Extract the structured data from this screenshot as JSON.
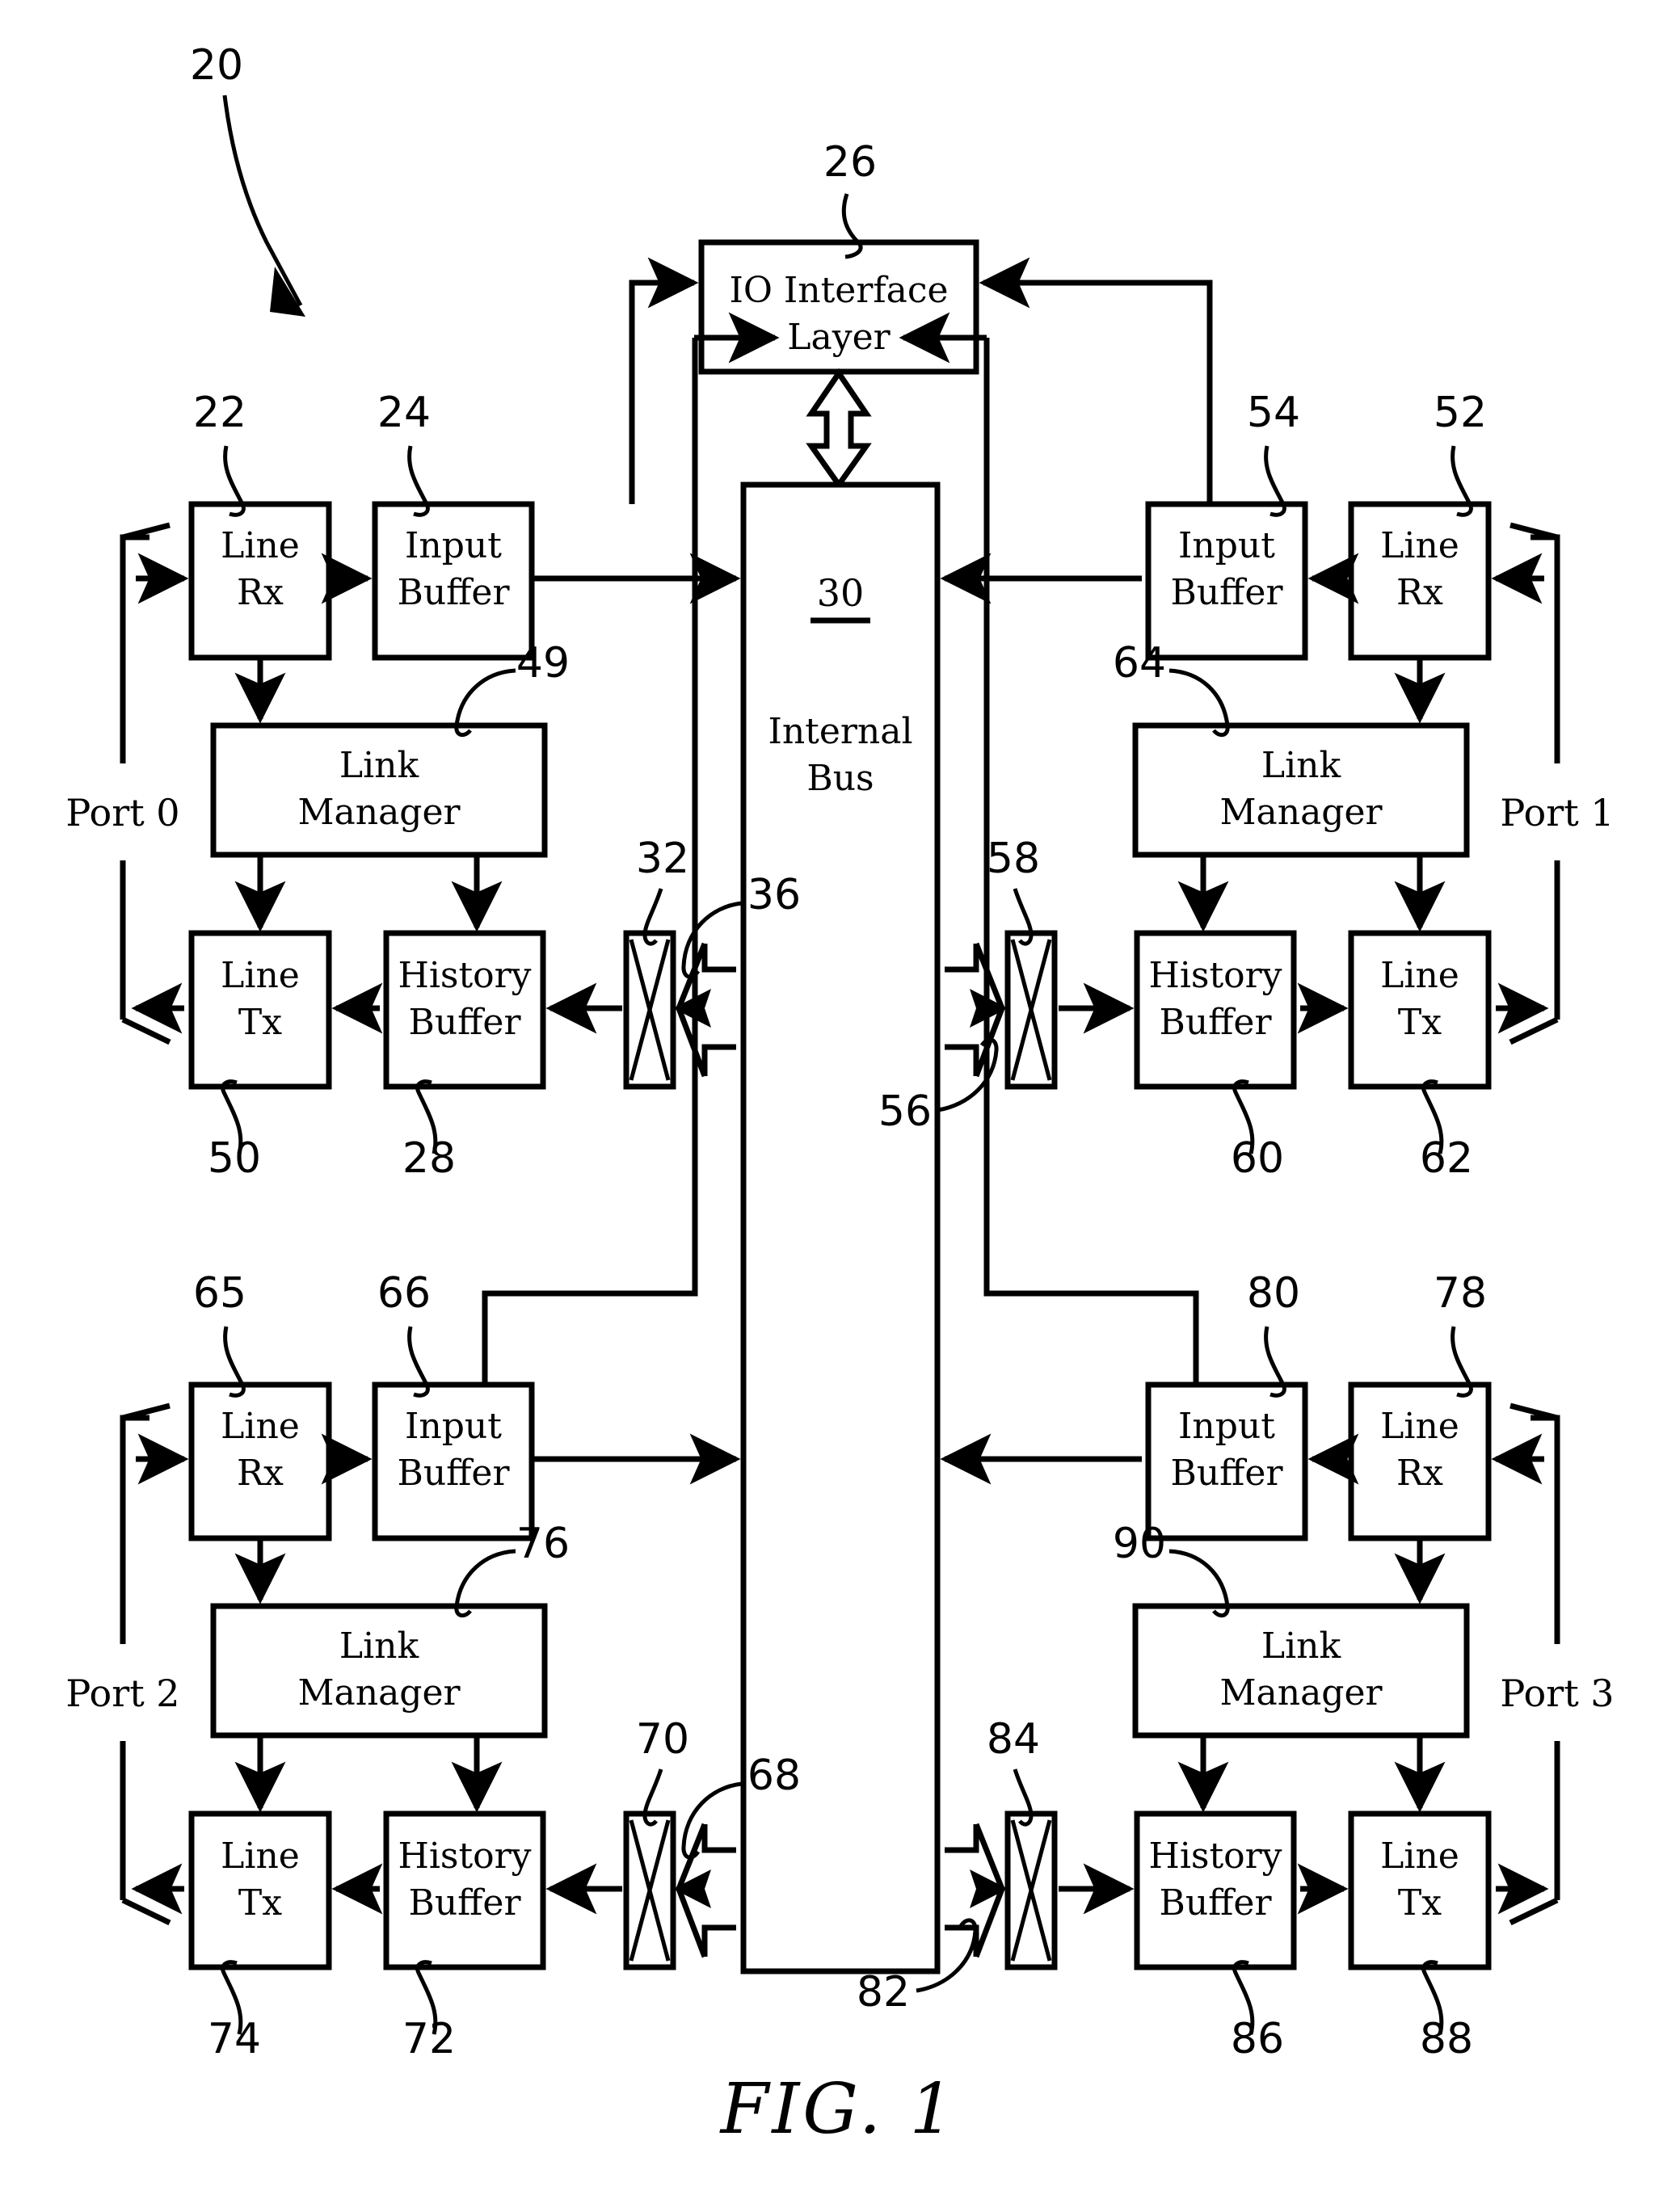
{
  "figure": {
    "caption": "FIG.  1",
    "system_ref": "20"
  },
  "blocks": {
    "io_interface": {
      "line1": "IO  Interface",
      "line2": "Layer",
      "ref": "26"
    },
    "internal_bus": {
      "num": "30",
      "line1": "Internal",
      "line2": "Bus"
    },
    "port0": {
      "label": "Port 0",
      "line_rx": {
        "line1": "Line",
        "line2": "Rx",
        "ref": "22"
      },
      "input_buf": {
        "line1": "Input",
        "line2": "Buffer",
        "ref": "24"
      },
      "link_mgr": {
        "line1": "Link",
        "line2": "Manager",
        "ref": "49"
      },
      "history": {
        "line1": "History",
        "line2": "Buffer",
        "ref": "28"
      },
      "line_tx": {
        "line1": "Line",
        "line2": "Tx",
        "ref": "50"
      },
      "mux_ref": "32",
      "bus_tap_ref": "36"
    },
    "port1": {
      "label": "Port 1",
      "line_rx": {
        "line1": "Line",
        "line2": "Rx",
        "ref": "52"
      },
      "input_buf": {
        "line1": "Input",
        "line2": "Buffer",
        "ref": "54"
      },
      "link_mgr": {
        "line1": "Link",
        "line2": "Manager",
        "ref": "64"
      },
      "history": {
        "line1": "History",
        "line2": "Buffer",
        "ref": "60"
      },
      "line_tx": {
        "line1": "Line",
        "line2": "Tx",
        "ref": "62"
      },
      "mux_ref": "58",
      "bus_tap_ref": "56"
    },
    "port2": {
      "label": "Port 2",
      "line_rx": {
        "line1": "Line",
        "line2": "Rx",
        "ref": "65"
      },
      "input_buf": {
        "line1": "Input",
        "line2": "Buffer",
        "ref": "66"
      },
      "link_mgr": {
        "line1": "Link",
        "line2": "Manager",
        "ref": "76"
      },
      "history": {
        "line1": "History",
        "line2": "Buffer",
        "ref": "72"
      },
      "line_tx": {
        "line1": "Line",
        "line2": "Tx",
        "ref": "74"
      },
      "mux_ref": "70",
      "bus_tap_ref": "68"
    },
    "port3": {
      "label": "Port 3",
      "line_rx": {
        "line1": "Line",
        "line2": "Rx",
        "ref": "78"
      },
      "input_buf": {
        "line1": "Input",
        "line2": "Buffer",
        "ref": "80"
      },
      "link_mgr": {
        "line1": "Link",
        "line2": "Manager",
        "ref": "90"
      },
      "history": {
        "line1": "History",
        "line2": "Buffer",
        "ref": "86"
      },
      "line_tx": {
        "line1": "Line",
        "line2": "Tx",
        "ref": "88"
      },
      "mux_ref": "84",
      "bus_tap_ref": "82"
    }
  },
  "colors": {
    "ink": "#000000",
    "paper": "#ffffff"
  }
}
